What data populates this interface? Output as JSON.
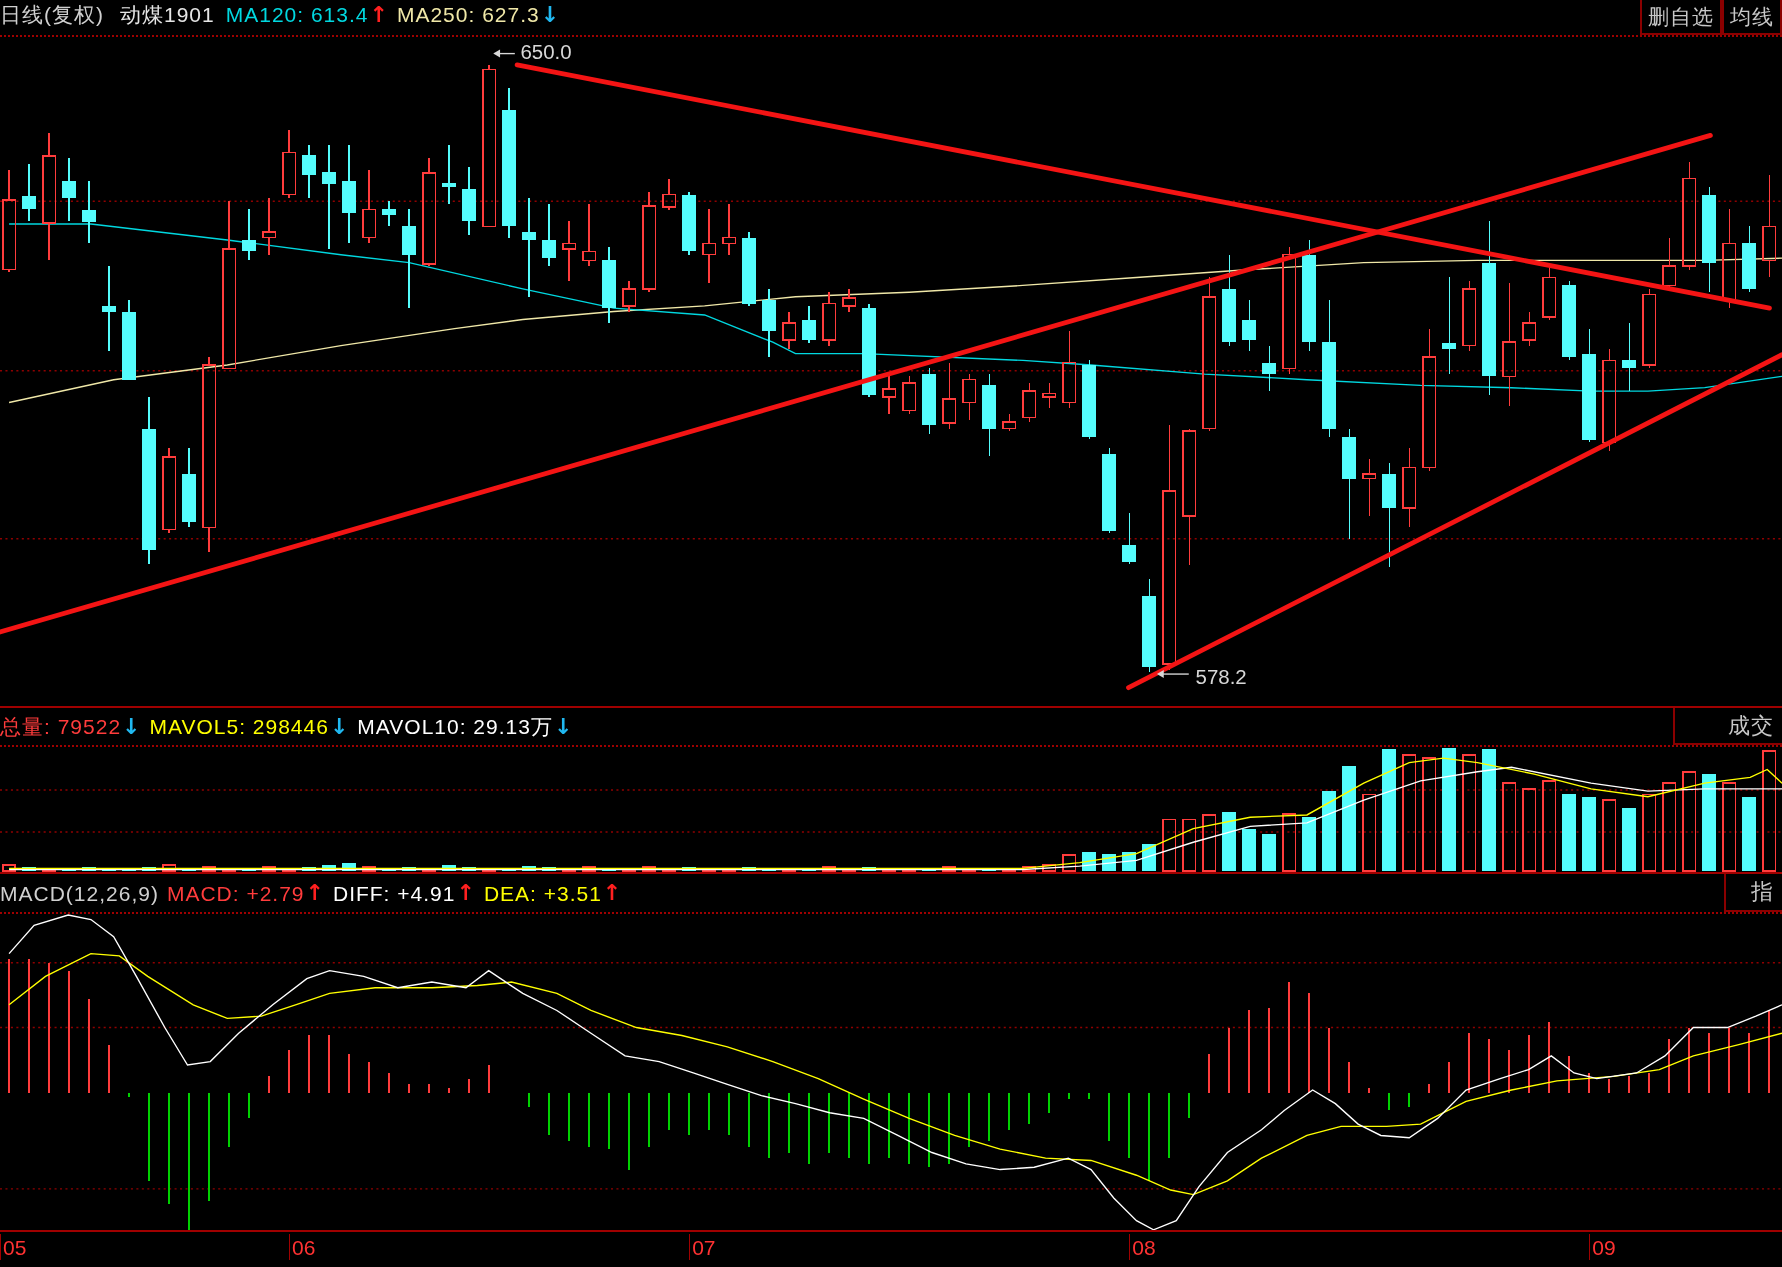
{
  "price_panel": {
    "period": "日线(复权)",
    "symbol": "动煤1901",
    "indicators": [
      {
        "text": "MA120: 613.4",
        "color": "#00d8e0",
        "arrow": {
          "text": "↑",
          "color": "#ff2020"
        }
      },
      {
        "text": "MA250: 627.3",
        "color": "#f0e8a8",
        "arrow": {
          "text": "↓",
          "color": "#20b8f0"
        }
      }
    ],
    "buttons": [
      "删自选",
      "均线"
    ],
    "annotations": [
      "650.0",
      "578.2"
    ]
  },
  "volume_panel": {
    "indicators": [
      {
        "text": "总量: 79522",
        "color": "#ff3c3c",
        "arrow": {
          "text": "↓",
          "color": "#20b8f0"
        }
      },
      {
        "text": "MAVOL5: 298446",
        "color": "#ffff00",
        "arrow": {
          "text": "↓",
          "color": "#20b8f0"
        }
      },
      {
        "text": "MAVOL10: 29.13万",
        "color": "#ffffff",
        "arrow": {
          "text": "↓",
          "color": "#20b8f0"
        }
      }
    ],
    "tab": "成交"
  },
  "macd_panel": {
    "title": "MACD(12,26,9)",
    "indicators": [
      {
        "text": "MACD: +2.79",
        "color": "#ff3c3c",
        "arrow": {
          "text": "↑",
          "color": "#ff2020"
        }
      },
      {
        "text": "DIFF: +4.91",
        "color": "#ffffff",
        "arrow": {
          "text": "↑",
          "color": "#ff2020"
        }
      },
      {
        "text": "DEA: +3.51",
        "color": "#ffff00",
        "arrow": {
          "text": "↑",
          "color": "#ff2020"
        }
      }
    ],
    "tab": "指"
  },
  "x_axis": {
    "labels": [
      "05",
      "06",
      "07",
      "08",
      "09"
    ]
  }
}
